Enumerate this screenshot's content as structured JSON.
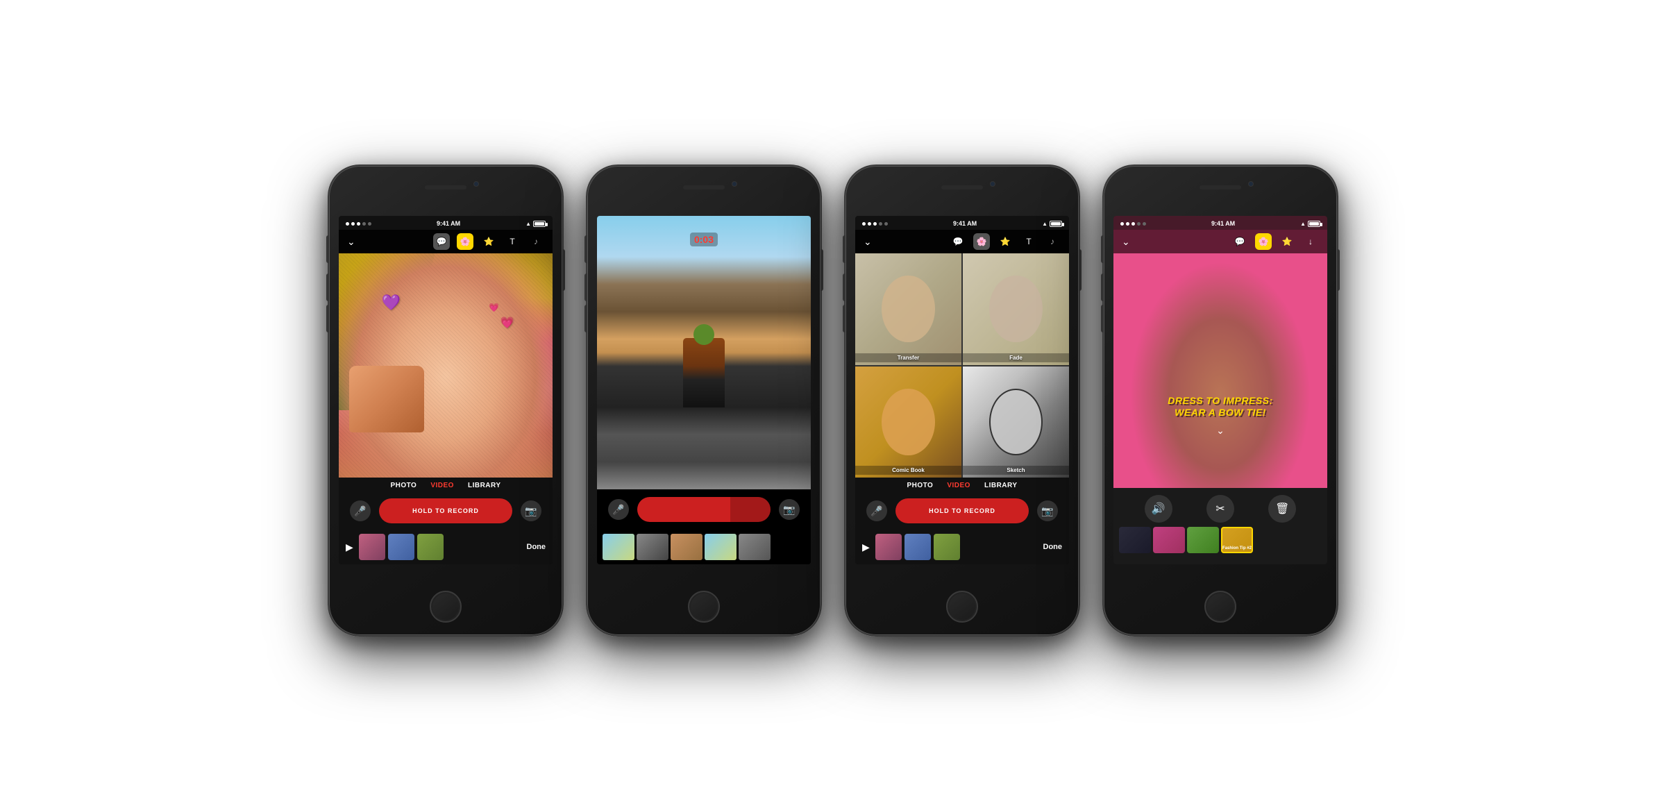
{
  "phones": [
    {
      "id": "phone1",
      "statusBar": {
        "time": "9:41 AM",
        "dots": 5
      },
      "toolbar": {
        "hasChevron": true,
        "icons": [
          "bubble",
          "sticker",
          "star",
          "text",
          "music"
        ]
      },
      "modeTabs": [
        "PHOTO",
        "VIDEO",
        "LIBRARY"
      ],
      "activeMode": "VIDEO",
      "recordButton": "HOLD TO RECORD",
      "filmstrip": [
        "thumb1",
        "thumb2",
        "thumb3"
      ],
      "doneLabel": "Done",
      "heartEmoji1": "💜",
      "heartEmoji2": "💗"
    },
    {
      "id": "phone2",
      "statusBar": {
        "time": "0:03"
      },
      "isRecording": true
    },
    {
      "id": "phone3",
      "statusBar": {
        "time": "9:41 AM",
        "dots": 5
      },
      "toolbar": {
        "hasChevron": true,
        "icons": [
          "bubble",
          "sticker",
          "star",
          "text",
          "music"
        ]
      },
      "modeTabs": [
        "PHOTO",
        "VIDEO",
        "LIBRARY"
      ],
      "activeMode": "VIDEO",
      "recordButton": "HOLD TO RECORD",
      "effects": [
        {
          "label": "Transfer"
        },
        {
          "label": "Fade"
        },
        {
          "label": "Comic Book"
        },
        {
          "label": "Sketch"
        }
      ],
      "doneLabel": "Done"
    },
    {
      "id": "phone4",
      "statusBar": {
        "time": "9:41 AM",
        "dots": 5
      },
      "toolbar": {
        "hasChevron": true,
        "icons": [
          "bubble",
          "sticker",
          "star",
          "download"
        ]
      },
      "overlayText": "DRESS TO IMPRESS:\nWEAR A BOW TIE!",
      "filmstrip": [
        {
          "label": ""
        },
        {
          "label": ""
        },
        {
          "label": ""
        },
        {
          "label": "Fashion Tip #2"
        }
      ],
      "controls": [
        "volume",
        "scissors",
        "trash"
      ]
    }
  ]
}
